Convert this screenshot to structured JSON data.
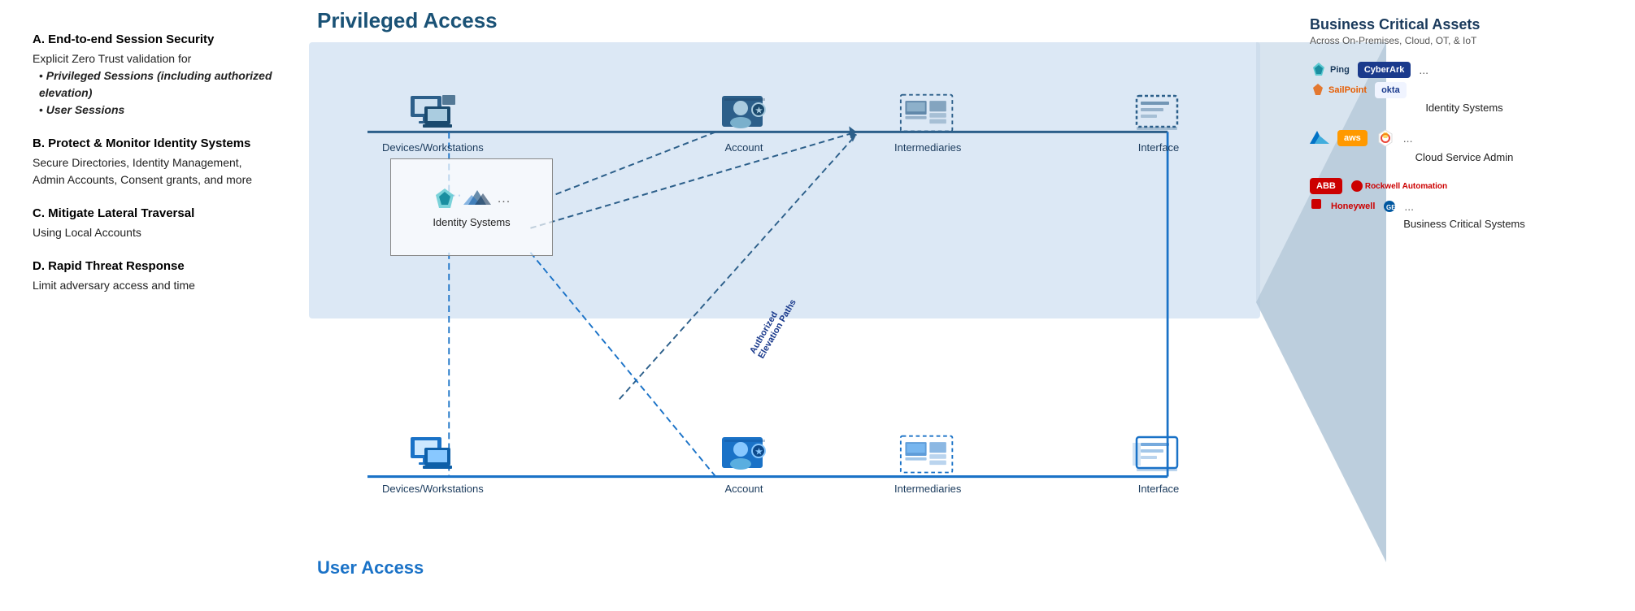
{
  "left": {
    "sections": [
      {
        "id": "A",
        "title": "A. End-to-end Session Security",
        "body": "Explicit Zero Trust validation for",
        "bullets": [
          "Privileged Sessions (including authorized elevation)",
          "User Sessions"
        ]
      },
      {
        "id": "B",
        "title": "B. Protect & Monitor Identity Systems",
        "body": "Secure Directories, Identity Management, Admin Accounts, Consent grants, and more"
      },
      {
        "id": "C",
        "title": "C. Mitigate Lateral Traversal",
        "body": "Using Local Accounts"
      },
      {
        "id": "D",
        "title": "D. Rapid Threat Response",
        "body": "Limit adversary access and time"
      }
    ]
  },
  "diagram": {
    "title": "Privileged Access",
    "user_access_label": "User Access",
    "priv_row": {
      "nodes": [
        {
          "id": "dw1",
          "label": "Devices/Workstations"
        },
        {
          "id": "acc1",
          "label": "Account"
        },
        {
          "id": "int1",
          "label": "Intermediaries"
        },
        {
          "id": "iface1",
          "label": "Interface"
        }
      ]
    },
    "user_row": {
      "nodes": [
        {
          "id": "dw2",
          "label": "Devices/Workstations"
        },
        {
          "id": "acc2",
          "label": "Account"
        },
        {
          "id": "int2",
          "label": "Intermediaries"
        },
        {
          "id": "iface2",
          "label": "Interface"
        }
      ]
    },
    "identity_box_label": "Identity Systems",
    "arrow_label": "Authorized\nElevation Paths"
  },
  "right": {
    "title": "Business Critical Assets",
    "subtitle": "Across On-Premises, Cloud, OT, & IoT",
    "sections": [
      {
        "label": "Identity Systems",
        "logos": [
          "Ping",
          "CyberArk",
          "...",
          "SailPoint",
          "okta"
        ]
      },
      {
        "label": "Cloud Service Admin",
        "logos": [
          "Azure",
          "aws",
          "GCP",
          "..."
        ]
      },
      {
        "label": "Business Critical Systems",
        "logos": [
          "ABB",
          "Rockwell Automation",
          "Honeywell",
          "GE",
          "..."
        ]
      }
    ]
  }
}
